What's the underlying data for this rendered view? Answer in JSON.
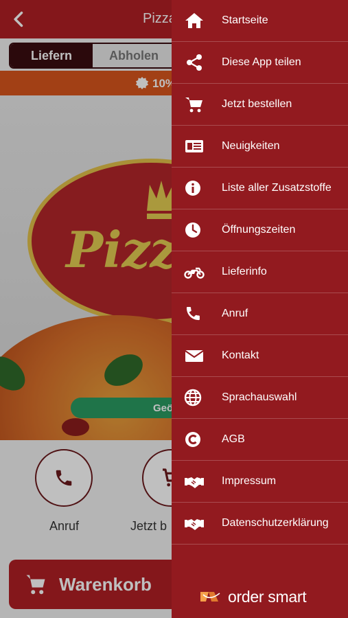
{
  "app": {
    "title": "Pizza",
    "tabs": [
      "Liefern",
      "Abholen"
    ],
    "promo_text": "10%",
    "cta_text": "Geö",
    "quick_actions": [
      "Anruf",
      "Jetzt b"
    ],
    "cart_label": "Warenkorb",
    "colors": {
      "primary": "#b01f24",
      "drawer": "#921a1f",
      "tab_active": "#3a0d10",
      "promo": "#d8561d",
      "cta": "#2a9b62"
    }
  },
  "drawer": {
    "items": [
      {
        "label": "Startseite",
        "icon": "home-icon"
      },
      {
        "label": "Diese App teilen",
        "icon": "share-icon"
      },
      {
        "label": "Jetzt bestellen",
        "icon": "cart-icon"
      },
      {
        "label": "Neuigkeiten",
        "icon": "news-icon"
      },
      {
        "label": "Liste aller Zusatzstoffe",
        "icon": "info-icon"
      },
      {
        "label": "Öffnungszeiten",
        "icon": "clock-icon"
      },
      {
        "label": "Lieferinfo",
        "icon": "motorbike-icon"
      },
      {
        "label": "Anruf",
        "icon": "phone-icon"
      },
      {
        "label": "Kontakt",
        "icon": "mail-icon"
      },
      {
        "label": "Sprachauswahl",
        "icon": "globe-icon"
      },
      {
        "label": "AGB",
        "icon": "copyright-icon"
      },
      {
        "label": "Impressum",
        "icon": "handshake-icon"
      },
      {
        "label": "Datenschutzerklärung",
        "icon": "handshake-icon"
      }
    ],
    "brand": "order smart"
  }
}
